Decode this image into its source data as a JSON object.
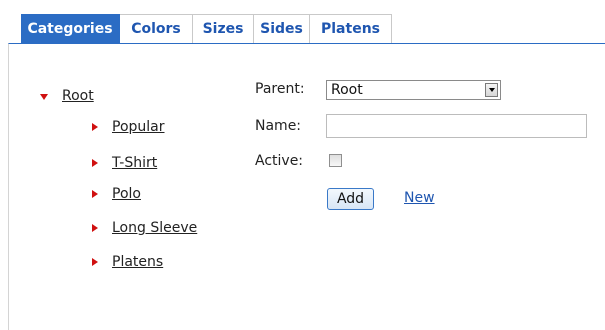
{
  "tabs": [
    {
      "label": "Categories",
      "active": true
    },
    {
      "label": "Colors",
      "active": false
    },
    {
      "label": "Sizes",
      "active": false
    },
    {
      "label": "Sides",
      "active": false
    },
    {
      "label": "Platens",
      "active": false
    }
  ],
  "tree": {
    "root": {
      "label": "Root",
      "expanded": true
    },
    "children": [
      {
        "label": "Popular"
      },
      {
        "label": "T-Shirt"
      },
      {
        "label": "Polo"
      },
      {
        "label": "Long Sleeve"
      },
      {
        "label": "Platens"
      }
    ]
  },
  "form": {
    "parent_label": "Parent:",
    "parent_value": "Root",
    "name_label": "Name:",
    "name_value": "",
    "active_label": "Active:",
    "active_checked": false,
    "add_label": "Add",
    "new_label": "New"
  },
  "colors": {
    "accent": "#2b6cc4",
    "tab_text": "#1f56b0",
    "tree_arrow": "#d01010"
  },
  "icons": {
    "expanded": "triangle-down-icon",
    "collapsed": "triangle-right-icon",
    "select": "dropdown-arrow-icon"
  }
}
